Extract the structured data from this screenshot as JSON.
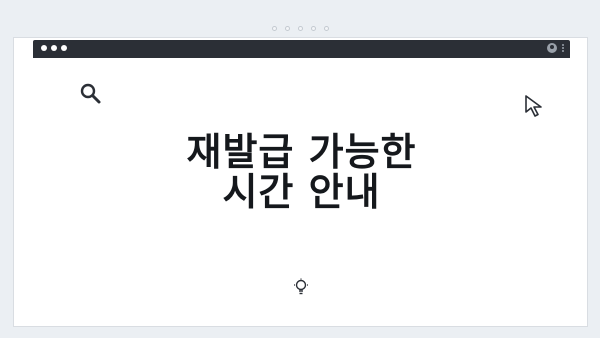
{
  "titlebar": {
    "window_controls": [
      "dot",
      "dot",
      "dot"
    ],
    "right_icons": [
      "user-icon",
      "kebab-menu-icon"
    ]
  },
  "content": {
    "heading_line1": "재발급 가능한",
    "heading_line2": "시간 안내"
  },
  "icons": [
    "search-icon",
    "cursor-icon",
    "lightbulb-icon"
  ],
  "colors": {
    "background": "#ebeff3",
    "titlebar": "#2b2f36",
    "heading": "#15181c"
  }
}
